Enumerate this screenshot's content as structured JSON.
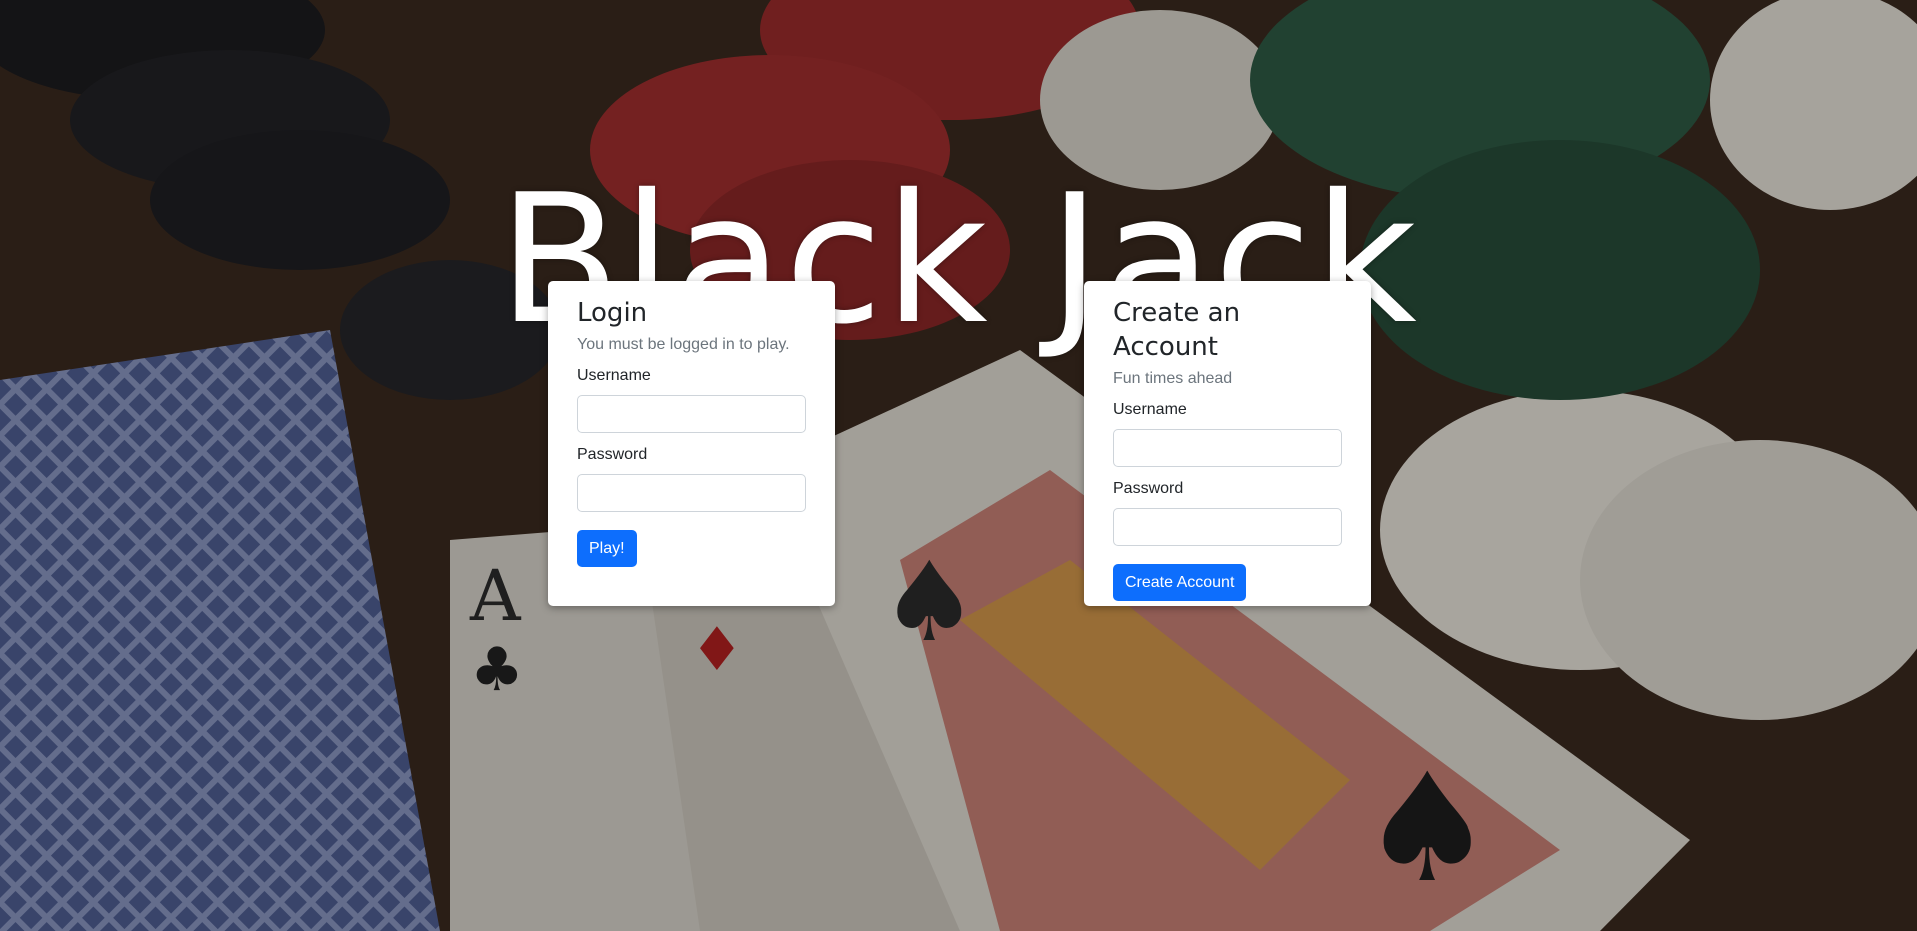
{
  "page": {
    "title": "Black Jack"
  },
  "login": {
    "title": "Login",
    "subtitle": "You must be logged in to play.",
    "username_label": "Username",
    "username_value": "",
    "password_label": "Password",
    "password_value": "",
    "submit_label": "Play!"
  },
  "signup": {
    "title": "Create an Account",
    "subtitle": "Fun times ahead",
    "username_label": "Username",
    "username_value": "",
    "password_label": "Password",
    "password_value": "",
    "submit_label": "Create Account"
  },
  "background": {
    "description": "playing cards and casino chips",
    "colors": {
      "wood": "#3b2a1f",
      "chip_red": "#a12f2f",
      "chip_green": "#2f5b45",
      "chip_black": "#1c1c1f",
      "chip_white": "#e6e2d8",
      "card_back": "#5d6fa3"
    }
  },
  "accent_color": "#0d6efd"
}
